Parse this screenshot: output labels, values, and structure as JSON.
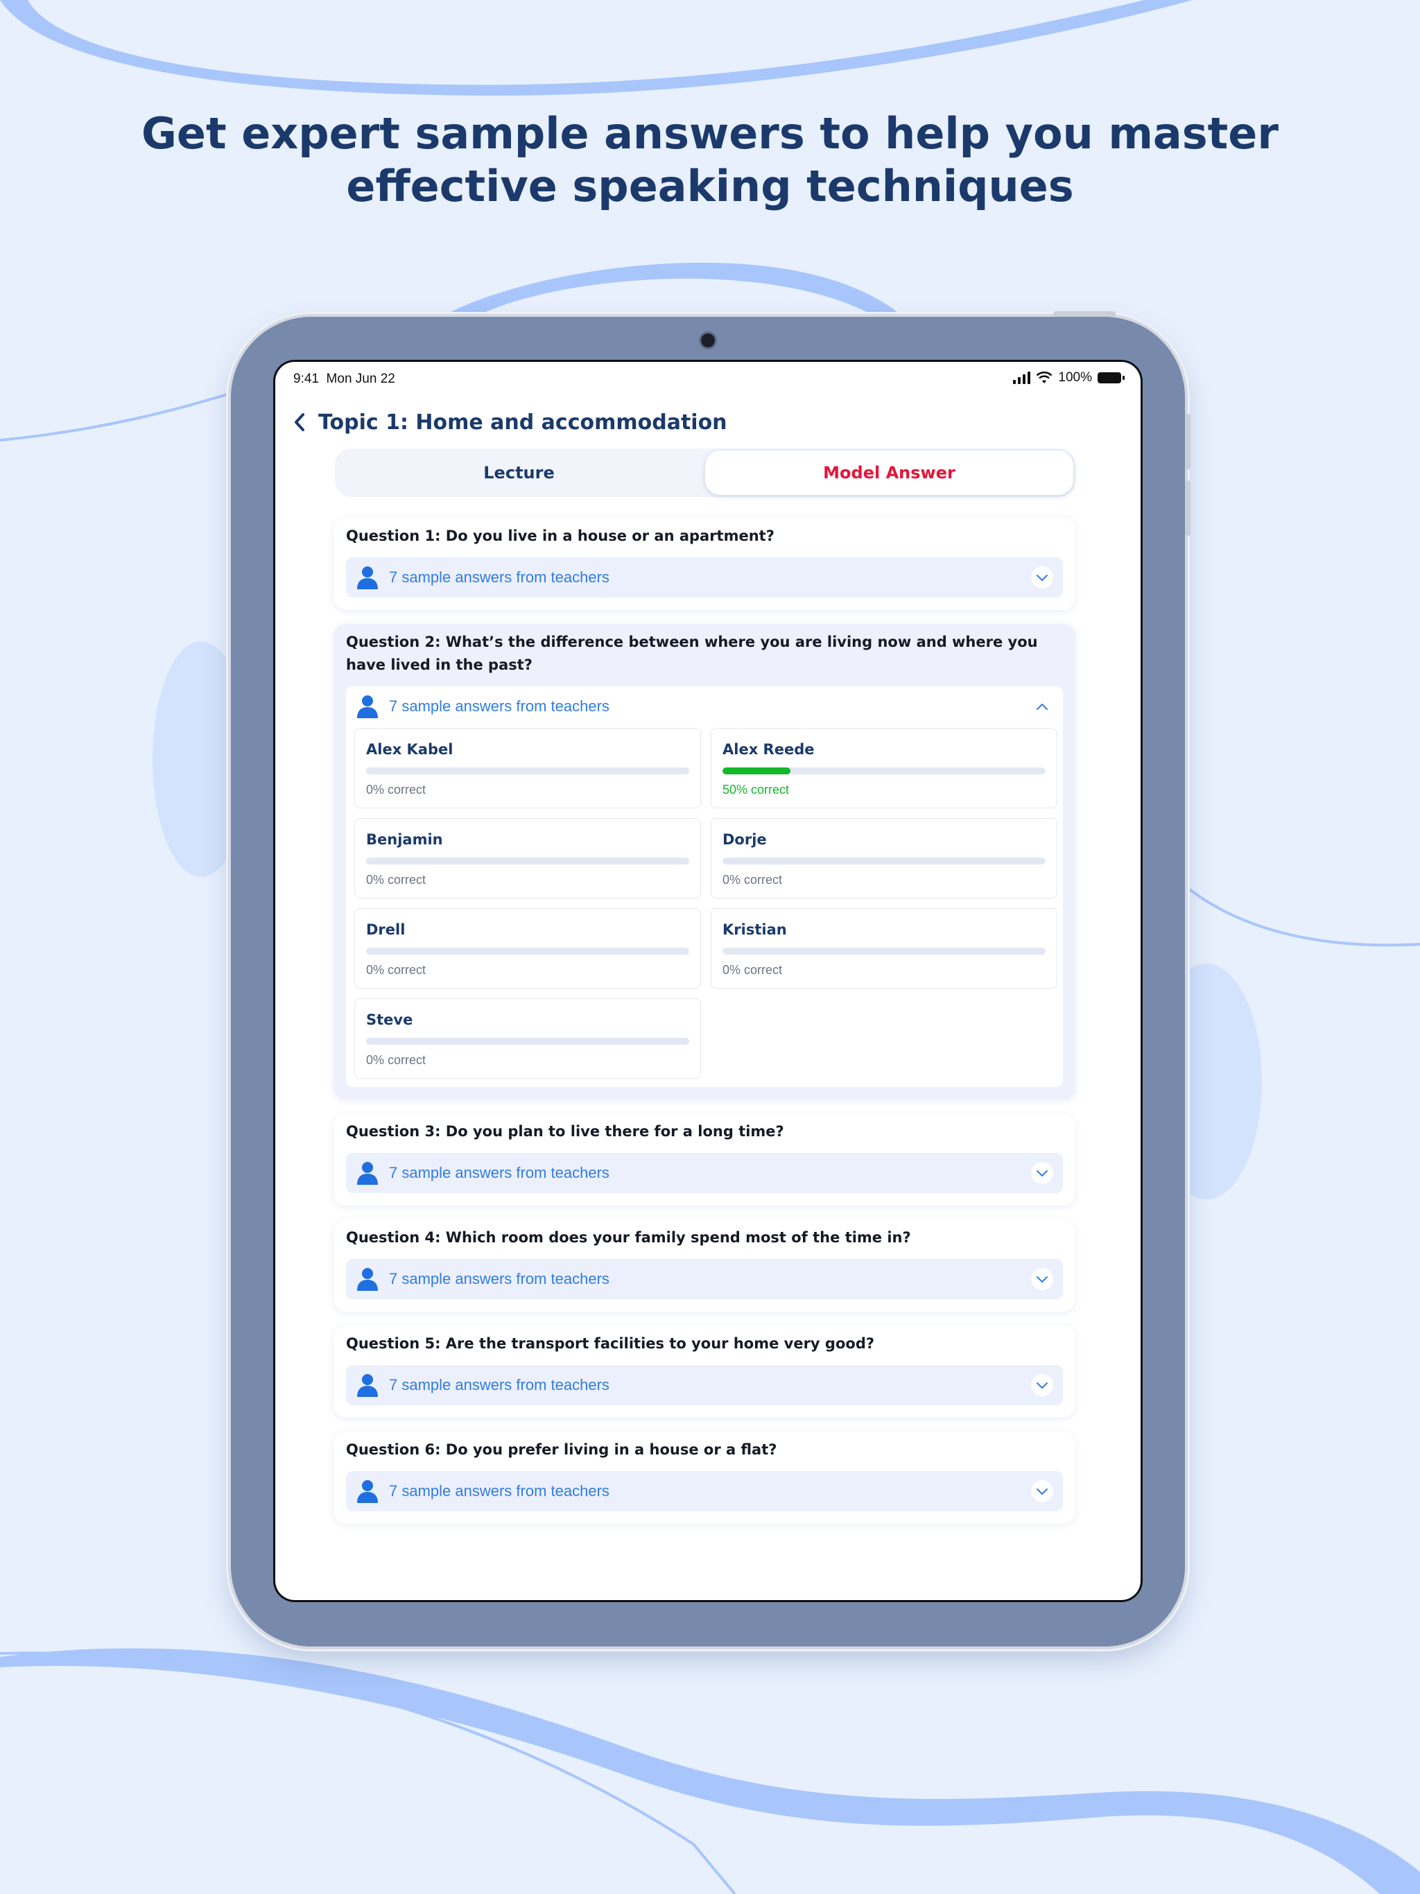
{
  "headline": {
    "line1": "Get expert sample answers to help you master",
    "line2": "effective speaking techniques"
  },
  "colors": {
    "background": "#e8f0fd",
    "accent_blue": "#2f7de1",
    "active_tab_red": "#e4163a",
    "title_navy": "#1b3a6b",
    "progress_green": "#13b82b"
  },
  "status_bar": {
    "time": "9:41",
    "date": "Mon Jun 22",
    "battery": "100%"
  },
  "header": {
    "back_icon": "chevron-left-icon",
    "title": "Topic 1: Home and accommodation"
  },
  "tabs": [
    {
      "label": "Lecture",
      "active": false
    },
    {
      "label": "Model Answer",
      "active": true
    }
  ],
  "questions": [
    {
      "text": "Question 1: Do you live in a house or an apartment?",
      "answers_label": "7 sample answers from teachers",
      "expanded": false
    },
    {
      "text": "Question 2: What’s the difference between where you are living now and where you have lived in the past?",
      "answers_label": "7 sample answers from teachers",
      "expanded": true,
      "teachers": [
        {
          "name": "Alex Kabel",
          "score": "0% correct",
          "progress": 0
        },
        {
          "name": "Alex Reede",
          "score": "50% correct",
          "progress": 0.21
        },
        {
          "name": "Benjamin",
          "score": "0% correct",
          "progress": 0
        },
        {
          "name": "Dorje",
          "score": "0% correct",
          "progress": 0
        },
        {
          "name": "Drell",
          "score": "0% correct",
          "progress": 0
        },
        {
          "name": "Kristian",
          "score": "0% correct",
          "progress": 0
        },
        {
          "name": "Steve",
          "score": "0% correct",
          "progress": 0
        }
      ]
    },
    {
      "text": "Question 3: Do you plan to live there for a long time?",
      "answers_label": "7 sample answers from teachers",
      "expanded": false
    },
    {
      "text": "Question 4: Which room does your family spend most of the time in?",
      "answers_label": "7 sample answers from teachers",
      "expanded": false
    },
    {
      "text": "Question 5: Are the transport facilities to your home very good?",
      "answers_label": "7 sample answers from teachers",
      "expanded": false
    },
    {
      "text": "Question 6: Do you prefer living in a house or a flat?",
      "answers_label": "7 sample answers from teachers",
      "expanded": false
    }
  ]
}
